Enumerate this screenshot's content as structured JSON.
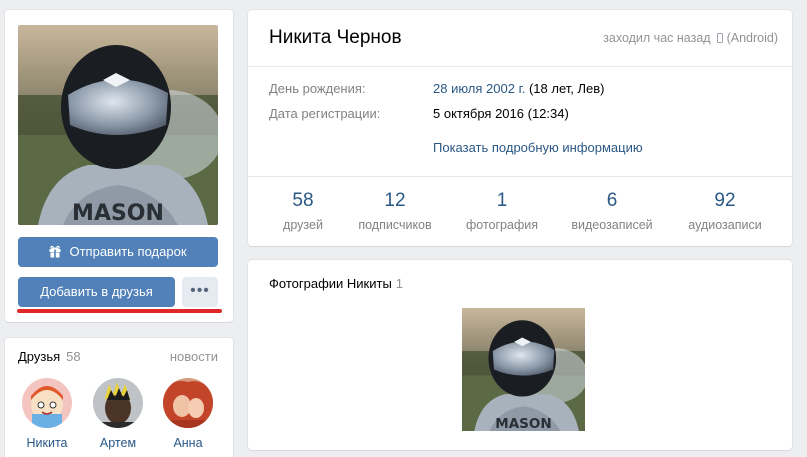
{
  "profile": {
    "name": "Никита Чернов",
    "online_status": "заходил час назад",
    "online_device": "(Android)",
    "birthday_label": "День рождения:",
    "birthday_date": "28 июля 2002 г.",
    "birthday_extra": "(18 лет, Лев)",
    "registration_label": "Дата регистрации:",
    "registration_value": "5 октября 2016 (12:34)",
    "show_more": "Показать подробную информацию"
  },
  "counters": [
    {
      "num": "58",
      "label": "друзей"
    },
    {
      "num": "12",
      "label": "подписчиков"
    },
    {
      "num": "1",
      "label": "фотография"
    },
    {
      "num": "6",
      "label": "видеозаписей"
    },
    {
      "num": "92",
      "label": "аудиозаписи"
    }
  ],
  "actions": {
    "gift": "Отправить подарок",
    "add_friend": "Добавить в друзья",
    "more": "•••"
  },
  "friends": {
    "title": "Друзья",
    "count": "58",
    "news_link": "новости",
    "items": [
      {
        "name": "Никита"
      },
      {
        "name": "Артем"
      },
      {
        "name": "Анна"
      }
    ]
  },
  "photos": {
    "title": "Фотографии Никиты",
    "count": "1"
  },
  "colors": {
    "accent": "#5181b8",
    "link": "#2a5885",
    "highlight": "#e02828"
  }
}
